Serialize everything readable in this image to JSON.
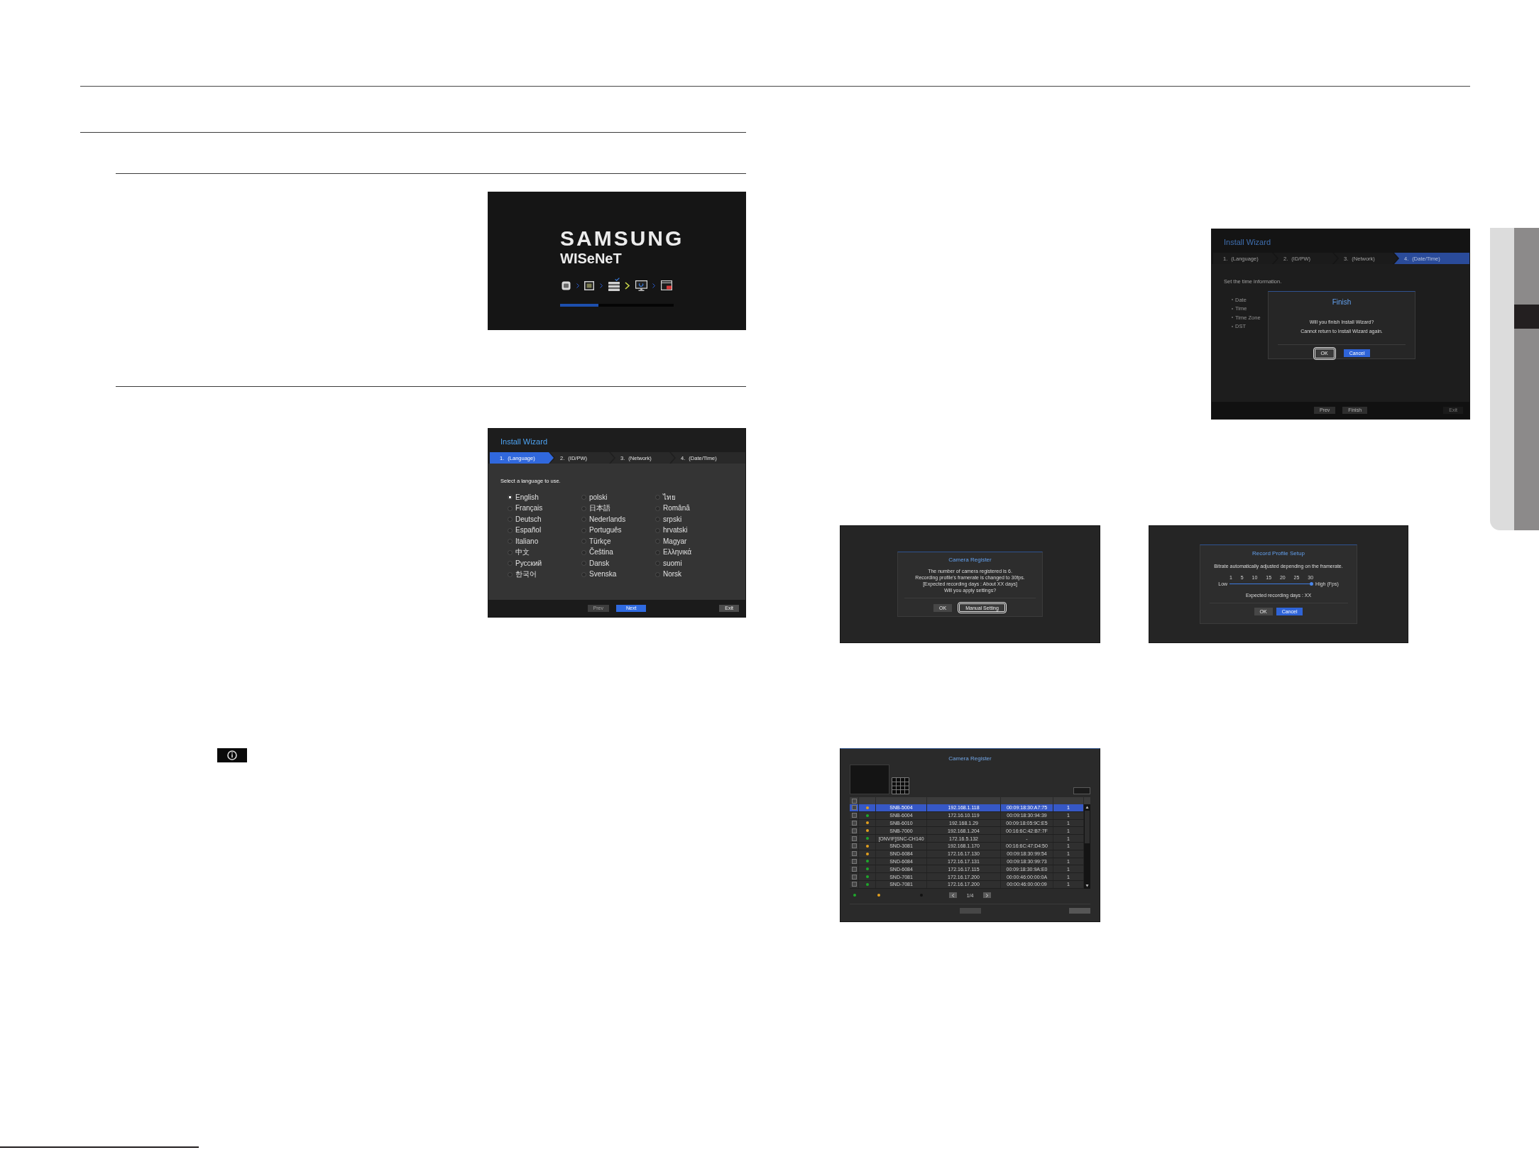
{
  "boot_screen": {
    "brand": "SAMSUNG",
    "product": "WISeNeT",
    "progress": {
      "level": 0.34
    }
  },
  "language_wizard": {
    "title": "Install Wizard",
    "steps": [
      {
        "label": "1. (Language)",
        "selected": true
      },
      {
        "label": "2. (ID/PW)",
        "selected": false
      },
      {
        "label": "3. (Network)",
        "selected": false
      },
      {
        "label": "4. (Date/Time)",
        "selected": false
      }
    ],
    "prompt": "Select a language to use.",
    "languages": [
      {
        "label": "English",
        "selected": true
      },
      {
        "label": "polski",
        "selected": false
      },
      {
        "label": "ไทย",
        "selected": false
      },
      {
        "label": "Français",
        "selected": false
      },
      {
        "label": "日本語",
        "selected": false
      },
      {
        "label": "Română",
        "selected": false
      },
      {
        "label": "Deutsch",
        "selected": false
      },
      {
        "label": "Nederlands",
        "selected": false
      },
      {
        "label": "srpski",
        "selected": false
      },
      {
        "label": "Español",
        "selected": false
      },
      {
        "label": "Português",
        "selected": false
      },
      {
        "label": "hrvatski",
        "selected": false
      },
      {
        "label": "Italiano",
        "selected": false
      },
      {
        "label": "Türkçe",
        "selected": false
      },
      {
        "label": "Magyar",
        "selected": false
      },
      {
        "label": "中文",
        "selected": false
      },
      {
        "label": "Čeština",
        "selected": false
      },
      {
        "label": "Ελληνικά",
        "selected": false
      },
      {
        "label": "Русский",
        "selected": false
      },
      {
        "label": "Dansk",
        "selected": false
      },
      {
        "label": "suomi",
        "selected": false
      },
      {
        "label": "한국어",
        "selected": false
      },
      {
        "label": "Svenska",
        "selected": false
      },
      {
        "label": "Norsk",
        "selected": false
      }
    ],
    "nav_buttons": [
      {
        "label": "Prev",
        "kind": "secondary",
        "disabled": true
      },
      {
        "label": "Next",
        "kind": "primary",
        "disabled": false
      }
    ],
    "exit_button": {
      "label": "Exit",
      "kind": "secondary",
      "disabled": false
    }
  },
  "finish_wizard": {
    "title": "Install Wizard",
    "steps": [
      {
        "label": "1. (Language)",
        "selected": false
      },
      {
        "label": "2. (ID/PW)",
        "selected": false
      },
      {
        "label": "3. (Network)",
        "selected": false
      },
      {
        "label": "4. (Date/Time)",
        "selected": true
      }
    ],
    "prompt": "Set the time information.",
    "fields": [
      "Date",
      "Time",
      "Time Zone",
      "DST"
    ],
    "dialog": {
      "title": "Finish",
      "lines": [
        "Will you finish Install Wizard?",
        "Cannot return to Install Wizard again."
      ],
      "buttons": [
        {
          "label": "OK",
          "kind": "secondary",
          "focused": true
        },
        {
          "label": "Cancel",
          "kind": "primary",
          "focused": false
        }
      ]
    },
    "nav_buttons": [
      {
        "label": "Prev",
        "kind": "secondary",
        "disabled": false
      },
      {
        "label": "Finish",
        "kind": "secondary",
        "disabled": false
      }
    ],
    "exit_button": {
      "label": "Exit",
      "kind": "secondary",
      "disabled": true
    }
  },
  "camera_register_prompt": {
    "dialog": {
      "title": "Camera Register",
      "lines": [
        "The number of camera registered is 6.",
        "Recording profile's framerate is changed to 30fps.",
        "[Expected recording days : About XX days]",
        "Will you apply settings?"
      ],
      "buttons": [
        {
          "label": "OK",
          "kind": "secondary",
          "focused": false
        },
        {
          "label": "Manual Setting",
          "kind": "secondary",
          "focused": true
        }
      ]
    }
  },
  "record_profile_setup": {
    "dialog": {
      "title": "Record Profile Setup",
      "description": "Bitrate automatically adjusted depending on the framerate.",
      "ticks": [
        "1",
        "5",
        "10",
        "15",
        "20",
        "25",
        "30"
      ],
      "low_label": "Low",
      "high_label": "High (Fps)",
      "framerate": {
        "level": 1
      },
      "expected_days": "Expected recording days : XX",
      "buttons": [
        {
          "label": "OK",
          "kind": "secondary",
          "focused": false
        },
        {
          "label": "Cancel",
          "kind": "primary",
          "focused": false
        }
      ]
    }
  },
  "camera_list": {
    "title": "Camera Register",
    "table": {
      "header_checkbox": {
        "checked": false
      },
      "rows": [
        {
          "checked": false,
          "color": "#e3a01e",
          "column_3": "SNB-5004",
          "column_4": "192.168.1.118",
          "column_5": "00:09:18:30:A7:75",
          "column_6": "1",
          "selected": true
        },
        {
          "checked": false,
          "color": "#1ea82b",
          "column_3": "SNB-6004",
          "column_4": "172.16.10.119",
          "column_5": "00:09:18:30:94:39",
          "column_6": "1",
          "selected": false
        },
        {
          "checked": false,
          "color": "#e3a01e",
          "column_3": "SNB-6010",
          "column_4": "192.168.1.29",
          "column_5": "00:09:18:05:9C:E5",
          "column_6": "1",
          "selected": false
        },
        {
          "checked": false,
          "color": "#e3a01e",
          "column_3": "SNB-7000",
          "column_4": "192.168.1.204",
          "column_5": "00:16:6C:42:B7:7F",
          "column_6": "1",
          "selected": false
        },
        {
          "checked": false,
          "color": "#1ea82b",
          "column_3": "[ONVIF]SNC-CH140",
          "column_4": "172.16.5.132",
          "column_5": "-",
          "column_6": "1",
          "selected": false
        },
        {
          "checked": false,
          "color": "#e3a01e",
          "column_3": "SND-3081",
          "column_4": "192.168.1.170",
          "column_5": "00:16:6C:47:D4:50",
          "column_6": "1",
          "selected": false
        },
        {
          "checked": false,
          "color": "#e3a01e",
          "column_3": "SND-6084",
          "column_4": "172.16.17.130",
          "column_5": "00:09:18:30:99:54",
          "column_6": "1",
          "selected": false
        },
        {
          "checked": false,
          "color": "#1ea82b",
          "column_3": "SND-6084",
          "column_4": "172.16.17.131",
          "column_5": "00:09:18:30:99:73",
          "column_6": "1",
          "selected": false
        },
        {
          "checked": false,
          "color": "#1ea82b",
          "column_3": "SND-6084",
          "column_4": "172.16.17.115",
          "column_5": "00:09:18:30:9A:E0",
          "column_6": "1",
          "selected": false
        },
        {
          "checked": false,
          "color": "#1ea82b",
          "column_3": "SND-7081",
          "column_4": "172.16.17.200",
          "column_5": "00:00:46:00:00:0A",
          "column_6": "1",
          "selected": false
        },
        {
          "checked": false,
          "color": "#1ea82b",
          "column_3": "SND-7081",
          "column_4": "172.16.17.200",
          "column_5": "00:00:46:00:00:09",
          "column_6": "1",
          "selected": false
        }
      ]
    },
    "legend": [
      {
        "color": "#1ea82b"
      },
      {
        "color": "#e3a01e"
      },
      {
        "color": "#111111"
      }
    ],
    "page": "1/4"
  }
}
